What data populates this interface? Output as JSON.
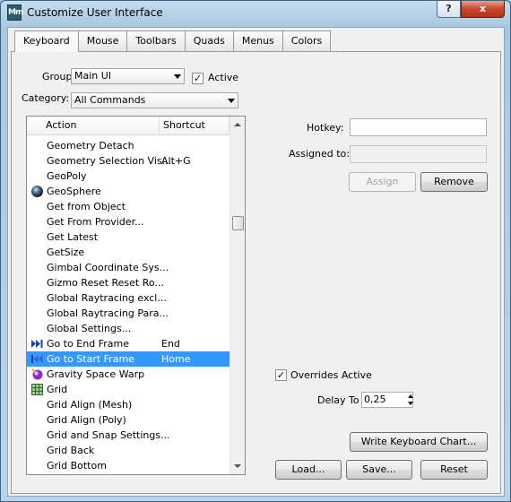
{
  "window": {
    "title": "Customize User Interface",
    "app_icon_text": "Mm",
    "help_label": "?",
    "close_label": "x"
  },
  "tabs": [
    {
      "label": "Keyboard",
      "active": true
    },
    {
      "label": "Mouse"
    },
    {
      "label": "Toolbars"
    },
    {
      "label": "Quads"
    },
    {
      "label": "Menus"
    },
    {
      "label": "Colors"
    }
  ],
  "keyboard": {
    "group_label": "Group:",
    "group_value": "Main UI",
    "active_label": "Active",
    "active_checked": true,
    "category_label": "Category:",
    "category_value": "All Commands",
    "list": {
      "col_action": "Action",
      "col_shortcut": "Shortcut",
      "rows": [
        {
          "action": "Geometry Detach",
          "shortcut": "",
          "icon": ""
        },
        {
          "action": "Geometry Selection Vis...",
          "shortcut": "Alt+G",
          "icon": ""
        },
        {
          "action": "GeoPoly",
          "shortcut": "",
          "icon": ""
        },
        {
          "action": "GeoSphere",
          "shortcut": "",
          "icon": "sphere-icon"
        },
        {
          "action": "Get from Object",
          "shortcut": "",
          "icon": ""
        },
        {
          "action": "Get From Provider...",
          "shortcut": "",
          "icon": ""
        },
        {
          "action": "Get Latest",
          "shortcut": "",
          "icon": ""
        },
        {
          "action": "GetSize",
          "shortcut": "",
          "icon": ""
        },
        {
          "action": "Gimbal Coordinate Sys...",
          "shortcut": "",
          "icon": ""
        },
        {
          "action": "Gizmo Reset Reset Ro...",
          "shortcut": "",
          "icon": ""
        },
        {
          "action": "Global Raytracing excl...",
          "shortcut": "",
          "icon": ""
        },
        {
          "action": "Global Raytracing Para...",
          "shortcut": "",
          "icon": ""
        },
        {
          "action": "Global Settings...",
          "shortcut": "",
          "icon": ""
        },
        {
          "action": "Go to End Frame",
          "shortcut": "End",
          "icon": "go-to-end-icon"
        },
        {
          "action": "Go to Start Frame",
          "shortcut": "Home",
          "icon": "go-to-start-icon",
          "selected": true
        },
        {
          "action": "Gravity Space Warp",
          "shortcut": "",
          "icon": "gravity-icon"
        },
        {
          "action": "Grid",
          "shortcut": "",
          "icon": "grid-icon"
        },
        {
          "action": "Grid Align (Mesh)",
          "shortcut": "",
          "icon": ""
        },
        {
          "action": "Grid Align (Poly)",
          "shortcut": "",
          "icon": ""
        },
        {
          "action": "Grid and Snap Settings...",
          "shortcut": "",
          "icon": ""
        },
        {
          "action": "Grid Back",
          "shortcut": "",
          "icon": ""
        },
        {
          "action": "Grid Bottom",
          "shortcut": "",
          "icon": ""
        }
      ]
    },
    "hotkey_label": "Hotkey:",
    "hotkey_value": "",
    "assigned_label": "Assigned to:",
    "assigned_value": "",
    "assign_button": "Assign",
    "remove_button": "Remove",
    "overrides_label": "Overrides Active",
    "overrides_checked": true,
    "delay_label": "Delay To",
    "delay_value": "0,25",
    "write_chart_button": "Write Keyboard Chart...",
    "load_button": "Load...",
    "save_button": "Save...",
    "reset_button": "Reset"
  },
  "colors": {
    "selection": "#3399ff",
    "close_button": "#c9462a"
  }
}
